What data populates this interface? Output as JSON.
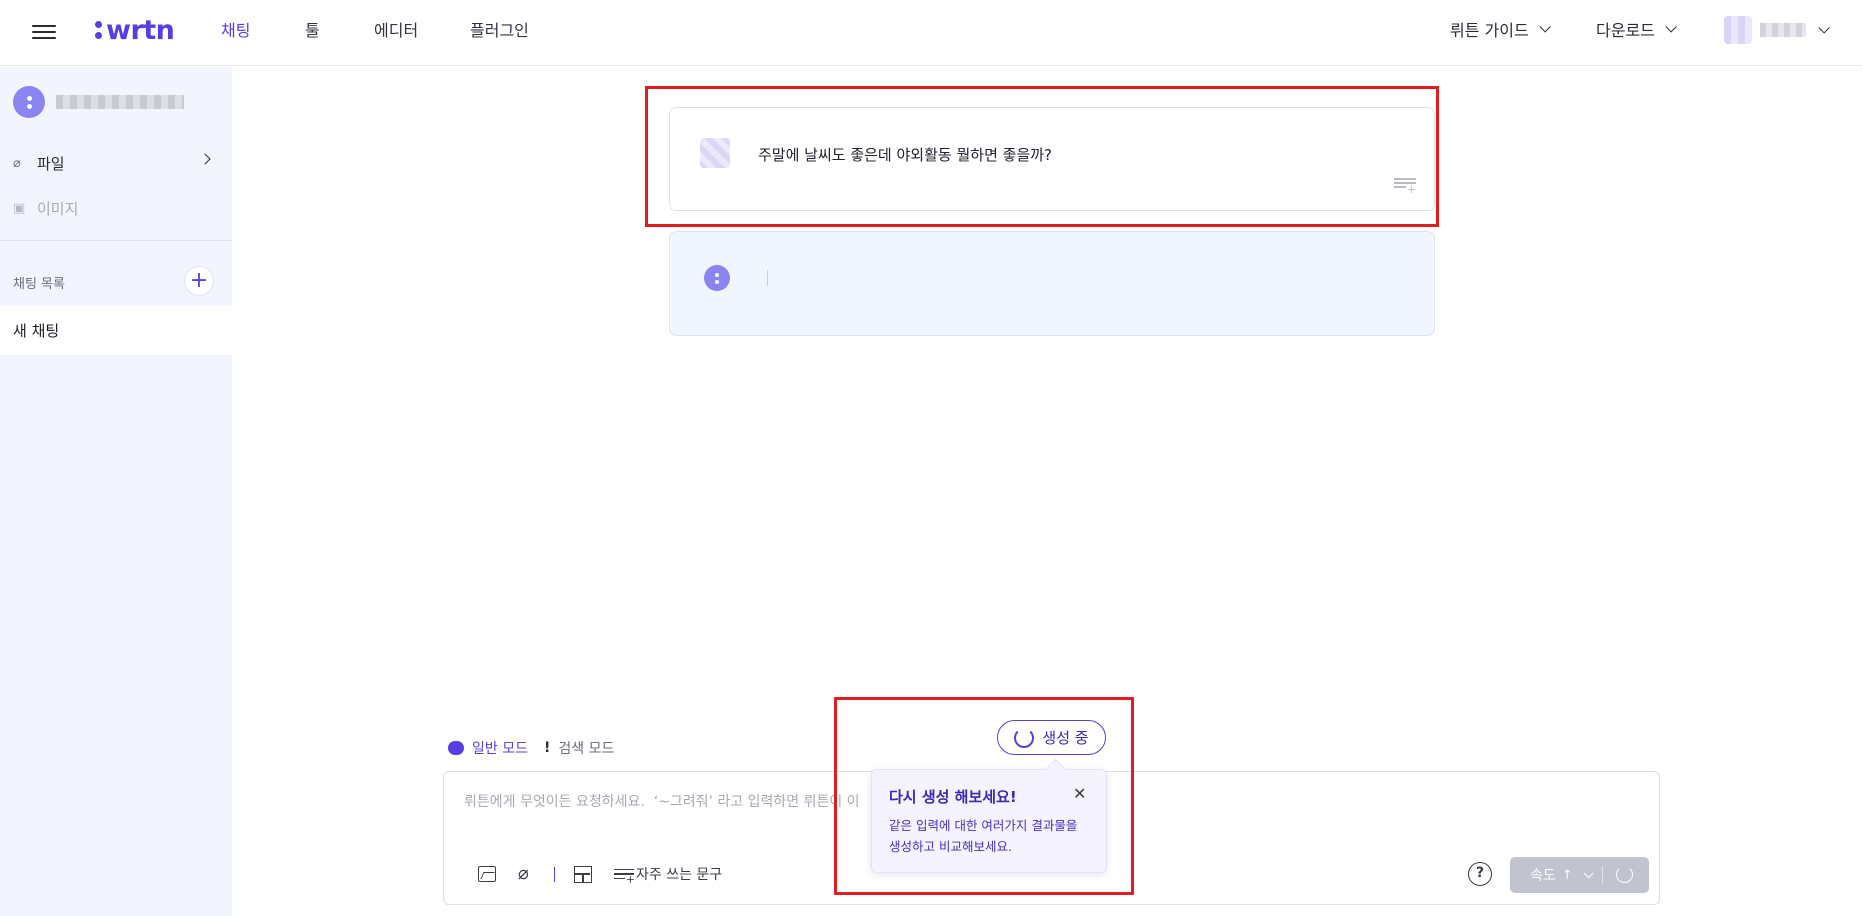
{
  "header": {
    "logo_text": "wrtn",
    "nav": [
      {
        "label": "채팅",
        "active": true
      },
      {
        "label": "툴",
        "active": false
      },
      {
        "label": "에디터",
        "active": false
      },
      {
        "label": "플러그인",
        "active": false
      }
    ],
    "guide_label": "뤼튼 가이드",
    "download_label": "다운로드"
  },
  "sidebar": {
    "file_label": "파일",
    "image_label": "이미지",
    "chat_list_label": "채팅 목록",
    "add_icon": "+",
    "chats": [
      {
        "label": "새 채팅"
      }
    ]
  },
  "messages": [
    {
      "role": "user",
      "text": "주말에 날씨도 좋은데 야외활동 뭘하면 좋을까?"
    },
    {
      "role": "assistant",
      "text": ""
    }
  ],
  "composer": {
    "modes": [
      {
        "label": "일반 모드",
        "active": true
      },
      {
        "label": "검색 모드",
        "active": false
      }
    ],
    "search_mode_mark": "!",
    "generating_label": "생성 중",
    "placeholder": "뤼튼에게 무엇이든 요청하세요.  ‘~그려줘’ 라고 입력하면 뤼튼이 이",
    "phrase_label": "자주 쓰는 문구",
    "help_label": "?",
    "speed_label": "속도",
    "speed_arrow": "↑"
  },
  "tooltip": {
    "title": "다시 생성 해보세요!",
    "body": "같은 입력에 대한 여러가지 결과물을 생성하고 비교해보세요.",
    "close_icon": "✕"
  },
  "icons": {
    "menu": "hamburger-icon",
    "file": "paperclip-icon",
    "image": "image-icon",
    "chat_mode": "speech-bubble-icon",
    "spinner": "spinner-icon",
    "refresh": "refresh-icon"
  },
  "colors": {
    "brand": "#5a3de0",
    "highlight": "#e11d1d",
    "sidebar_bg": "#f3f5fe",
    "bot_bubble_bg": "#f1f5fe",
    "tooltip_bg": "#f5f3ff"
  }
}
